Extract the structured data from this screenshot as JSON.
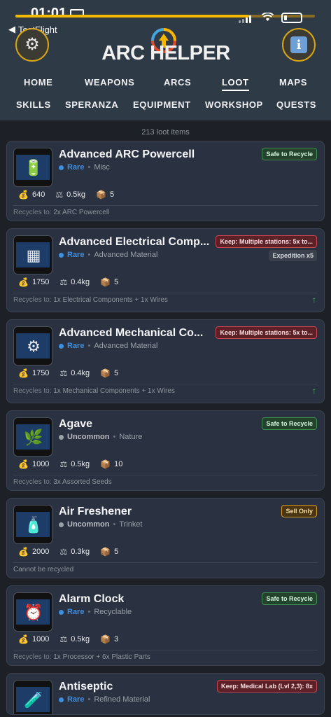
{
  "status_bar": {
    "time": "01:01",
    "back_label": "TestFlight",
    "progress": 0.78
  },
  "header": {
    "logo_text": "ARC HELPER",
    "nav_row1": [
      "HOME",
      "WEAPONS",
      "ARCS",
      "LOOT",
      "MAPS"
    ],
    "nav_row2": [
      "SKILLS",
      "SPERANZA",
      "EQUIPMENT",
      "WORKSHOP",
      "QUESTS"
    ],
    "active_tab": "LOOT"
  },
  "count_text": "213 loot items",
  "recycles_prefix": "Recycles to:",
  "colors": {
    "rare": "#3d8fe0",
    "uncommon": "#9aa1aa",
    "accent": "#f5b800"
  },
  "items": [
    {
      "name": "Advanced ARC Powercell",
      "rarity": "Rare",
      "category": "Misc",
      "badge": "Safe to Recycle",
      "badge_style": "green",
      "subbadge": "",
      "price": "640",
      "weight": "0.5kg",
      "stack": "5",
      "recycles": "2x ARC Powercell",
      "no_recycle_text": "",
      "trend_up": false,
      "thumb_icon": "powercell-icon"
    },
    {
      "name": "Advanced Electrical Comp...",
      "rarity": "Rare",
      "category": "Advanced Material",
      "badge": "Keep: Multiple stations: 5x to...",
      "badge_style": "red",
      "subbadge": "Expedition x5",
      "price": "1750",
      "weight": "0.4kg",
      "stack": "5",
      "recycles": "1x Electrical Components + 1x Wires",
      "no_recycle_text": "",
      "trend_up": true,
      "thumb_icon": "circuit-board-icon"
    },
    {
      "name": "Advanced Mechanical Co...",
      "rarity": "Rare",
      "category": "Advanced Material",
      "badge": "Keep: Multiple stations: 5x to...",
      "badge_style": "red",
      "subbadge": "",
      "price": "1750",
      "weight": "0.4kg",
      "stack": "5",
      "recycles": "1x Mechanical Components + 1x Wires",
      "no_recycle_text": "",
      "trend_up": true,
      "thumb_icon": "mechanical-part-icon"
    },
    {
      "name": "Agave",
      "rarity": "Uncommon",
      "category": "Nature",
      "badge": "Safe to Recycle",
      "badge_style": "green",
      "subbadge": "",
      "price": "1000",
      "weight": "0.5kg",
      "stack": "10",
      "recycles": "3x Assorted Seeds",
      "no_recycle_text": "",
      "trend_up": false,
      "thumb_icon": "plant-icon"
    },
    {
      "name": "Air Freshener",
      "rarity": "Uncommon",
      "category": "Trinket",
      "badge": "Sell Only",
      "badge_style": "orange",
      "subbadge": "",
      "price": "2000",
      "weight": "0.3kg",
      "stack": "5",
      "recycles": "",
      "no_recycle_text": "Cannot be recycled",
      "trend_up": false,
      "thumb_icon": "spray-can-icon"
    },
    {
      "name": "Alarm Clock",
      "rarity": "Rare",
      "category": "Recyclable",
      "badge": "Safe to Recycle",
      "badge_style": "green",
      "subbadge": "",
      "price": "1000",
      "weight": "0.5kg",
      "stack": "3",
      "recycles": "1x Processor + 6x Plastic Parts",
      "no_recycle_text": "",
      "trend_up": false,
      "thumb_icon": "clock-icon"
    },
    {
      "name": "Antiseptic",
      "rarity": "Rare",
      "category": "Refined Material",
      "badge": "Keep: Medical Lab (Lvl 2,3): 8x",
      "badge_style": "red",
      "subbadge": "",
      "price": "",
      "weight": "",
      "stack": "",
      "recycles": "",
      "no_recycle_text": "",
      "trend_up": false,
      "thumb_icon": "bottle-icon"
    }
  ]
}
